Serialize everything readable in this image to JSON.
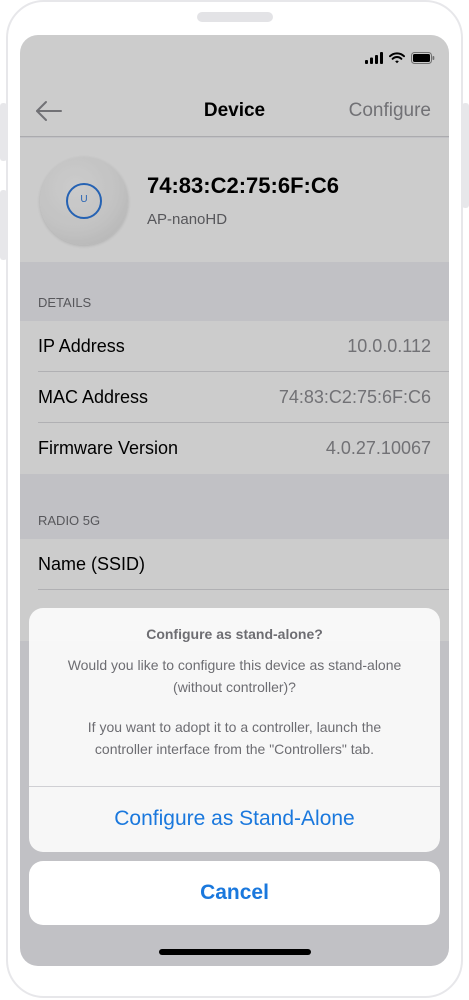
{
  "nav": {
    "title": "Device",
    "action": "Configure"
  },
  "device": {
    "mac": "74:83:C2:75:6F:C6",
    "model": "AP-nanoHD",
    "logo": "U"
  },
  "details": {
    "header": "DETAILS",
    "rows": [
      {
        "label": "IP Address",
        "value": "10.0.0.112"
      },
      {
        "label": "MAC Address",
        "value": "74:83:C2:75:6F:C6"
      },
      {
        "label": "Firmware Version",
        "value": "4.0.27.10067"
      }
    ]
  },
  "radio": {
    "header": "RADIO 5G",
    "rows": [
      {
        "label": "Name (SSID)",
        "value": ""
      }
    ]
  },
  "sheet": {
    "title": "Configure as stand-alone?",
    "message_1": "Would you like to configure this device as stand-alone (without controller)?",
    "message_2": "If you want to adopt it to a controller, launch the controller interface from the \"Controllers\" tab.",
    "action": "Configure as Stand-Alone",
    "cancel": "Cancel"
  },
  "colors": {
    "accent": "#1a78dd",
    "device_ring": "#2f7be0"
  },
  "icons": {
    "back": "arrow-left-icon",
    "signal": "cellular-signal-icon",
    "wifi": "wifi-icon",
    "battery": "battery-icon"
  }
}
